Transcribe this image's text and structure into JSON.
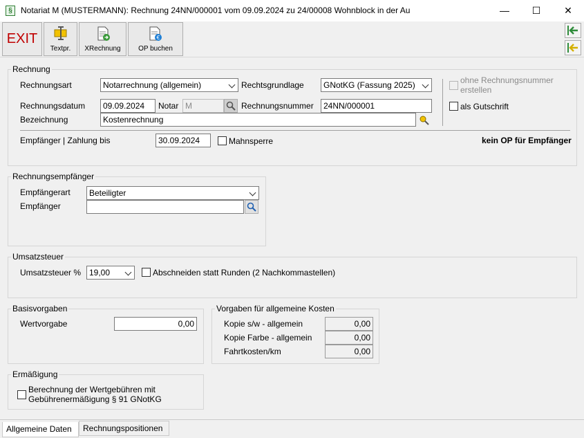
{
  "window": {
    "title": "Notariat M (MUSTERMANN): Rechnung 24NN/000001 vom 09.09.2024 zu 24/00008 Wohnblock in der Au",
    "app_icon_glyph": "§",
    "minimize_glyph": "—",
    "maximize_glyph": "☐",
    "close_glyph": "✕"
  },
  "toolbar": {
    "exit_label": "EXIT",
    "textpr_label": "Textpr.",
    "xrechnung_label": "XRechnung",
    "op_buchen_label": "OP buchen"
  },
  "rechnung": {
    "group_title": "Rechnung",
    "rechnungsart_label": "Rechnungsart",
    "rechnungsart_value": "Notarrechnung (allgemein)",
    "rechtsgrundlage_label": "Rechtsgrundlage",
    "rechtsgrundlage_value": "GNotKG (Fassung 2025)",
    "ohne_nummer_label_1": "ohne Rechnungsnummer",
    "ohne_nummer_label_2": "erstellen",
    "rechnungsdatum_label": "Rechnungsdatum",
    "rechnungsdatum_value": "09.09.2024",
    "notar_label": "Notar",
    "notar_value": "M",
    "rechnungsnummer_label": "Rechnungsnummer",
    "rechnungsnummer_value": "24NN/000001",
    "als_gutschrift_label": "als Gutschrift",
    "bezeichnung_label": "Bezeichnung",
    "bezeichnung_value": "Kostenrechnung",
    "empfaenger_zahlung_label": "Empfänger | Zahlung bis",
    "zahlung_bis_value": "30.09.2024",
    "mahnsperre_label": "Mahnsperre",
    "kein_op_text": "kein OP für Empfänger"
  },
  "empfaenger": {
    "group_title": "Rechnungsempfänger",
    "empfaengerart_label": "Empfängerart",
    "empfaengerart_value": "Beteiligter",
    "empfaenger_label": "Empfänger",
    "empfaenger_value": ""
  },
  "ust": {
    "group_title": "Umsatzsteuer",
    "ust_label": "Umsatzsteuer %",
    "ust_value": "19,00",
    "abschneiden_label": "Abschneiden statt Runden (2 Nachkommastellen)"
  },
  "basis": {
    "group_title": "Basisvorgaben",
    "wertvorgabe_label": "Wertvorgabe",
    "wertvorgabe_value": "0,00"
  },
  "kosten": {
    "group_title": "Vorgaben für allgemeine Kosten",
    "rows": [
      {
        "label": "Kopie s/w - allgemein",
        "value": "0,00"
      },
      {
        "label": "Kopie Farbe - allgemein",
        "value": "0,00"
      },
      {
        "label": "Fahrtkosten/km",
        "value": "0,00"
      }
    ]
  },
  "ermaessigung": {
    "group_title": "Ermäßigung",
    "label_1": "Berechnung der Wertgebühren mit",
    "label_2": "Gebührenermäßigung § 91 GNotKG"
  },
  "tabs": [
    {
      "label": "Allgemeine Daten",
      "active": true
    },
    {
      "label": "Rechnungspositionen",
      "active": false
    }
  ],
  "colors": {
    "exit_red": "#c00000",
    "nav_green": "#2e8b3a",
    "folder_yellow": "#f2c200"
  }
}
